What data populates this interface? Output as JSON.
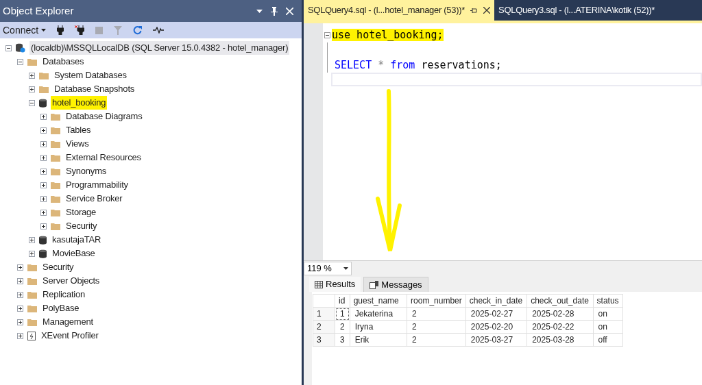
{
  "object_explorer": {
    "title": "Object Explorer",
    "toolbar": {
      "connect": "Connect"
    },
    "tree": [
      {
        "kind": "server",
        "label": "(localdb)\\MSSQLLocalDB (SQL Server 15.0.4382 - hotel_manager)",
        "expanded": true,
        "selected": true,
        "children": [
          {
            "kind": "folder",
            "label": "Databases",
            "expanded": true,
            "children": [
              {
                "kind": "folder",
                "label": "System Databases",
                "expanded": false
              },
              {
                "kind": "folder",
                "label": "Database Snapshots",
                "expanded": false
              },
              {
                "kind": "database",
                "label": "hotel_booking",
                "expanded": true,
                "highlighted": true,
                "children": [
                  {
                    "kind": "folder",
                    "label": "Database Diagrams",
                    "expanded": false
                  },
                  {
                    "kind": "folder",
                    "label": "Tables",
                    "expanded": false
                  },
                  {
                    "kind": "folder",
                    "label": "Views",
                    "expanded": false
                  },
                  {
                    "kind": "folder",
                    "label": "External Resources",
                    "expanded": false
                  },
                  {
                    "kind": "folder",
                    "label": "Synonyms",
                    "expanded": false
                  },
                  {
                    "kind": "folder",
                    "label": "Programmability",
                    "expanded": false
                  },
                  {
                    "kind": "folder",
                    "label": "Service Broker",
                    "expanded": false
                  },
                  {
                    "kind": "folder",
                    "label": "Storage",
                    "expanded": false
                  },
                  {
                    "kind": "folder",
                    "label": "Security",
                    "expanded": false
                  }
                ]
              },
              {
                "kind": "database",
                "label": "kasutajaTAR",
                "expanded": false
              },
              {
                "kind": "database",
                "label": "MovieBase",
                "expanded": false
              }
            ]
          },
          {
            "kind": "folder",
            "label": "Security",
            "expanded": false
          },
          {
            "kind": "folder",
            "label": "Server Objects",
            "expanded": false
          },
          {
            "kind": "folder",
            "label": "Replication",
            "expanded": false
          },
          {
            "kind": "folder",
            "label": "PolyBase",
            "expanded": false
          },
          {
            "kind": "folder",
            "label": "Management",
            "expanded": false
          },
          {
            "kind": "profiler",
            "label": "XEvent Profiler",
            "expanded": false
          }
        ]
      }
    ]
  },
  "editor_tabs": [
    {
      "label": "SQLQuery4.sql - (l...hotel_manager (53))*",
      "selected": true
    },
    {
      "label": "SQLQuery3.sql - (l...ATERINA\\kotik (52))*",
      "selected": false
    }
  ],
  "code_lines": [
    {
      "kind": "code",
      "tokens": [
        {
          "kind": "keyword_plain",
          "text": "use hotel_booking;"
        }
      ]
    },
    {
      "kind": "blank"
    },
    {
      "kind": "code",
      "tokens": [
        {
          "kind": "keyword",
          "text": "SELECT"
        },
        {
          "kind": "operator",
          "text": " * "
        },
        {
          "kind": "keyword",
          "text": "from"
        },
        {
          "kind": "plain",
          "text": " reservations;"
        }
      ]
    }
  ],
  "zoom": "119 %",
  "result_tabs": [
    {
      "label": "Results",
      "selected": true
    },
    {
      "label": "Messages",
      "selected": false
    }
  ],
  "grid": {
    "columns": [
      "id",
      "guest_name",
      "room_number",
      "check_in_date",
      "check_out_date",
      "status"
    ],
    "rows": [
      {
        "number": "1",
        "cells": [
          "1",
          "Jekaterina",
          "2",
          "2025-02-27",
          "2025-02-28",
          "on"
        ]
      },
      {
        "number": "2",
        "cells": [
          "2",
          "Iryna",
          "2",
          "2025-02-20",
          "2025-02-22",
          "on"
        ]
      },
      {
        "number": "3",
        "cells": [
          "3",
          "Erik",
          "2",
          "2025-03-27",
          "2025-03-28",
          "off"
        ]
      }
    ]
  }
}
